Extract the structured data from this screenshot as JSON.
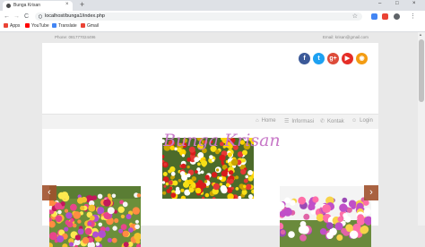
{
  "browser": {
    "tab_title": "Bunga Krisan",
    "new_tab": "+",
    "tab_close": "×",
    "url": "localhost/bunga1/index.php",
    "window_controls": [
      "–",
      "□",
      "×"
    ],
    "nav": {
      "back": "←",
      "forward": "→",
      "reload": "C",
      "star": "☆",
      "menu": "⋮"
    }
  },
  "bookmarks": [
    {
      "label": "Apps",
      "icon": "apps-icon",
      "color": "#ea4335"
    },
    {
      "label": "YouTube",
      "icon": "youtube-icon",
      "color": "#ff0000"
    },
    {
      "label": "Translate",
      "icon": "translate-icon",
      "color": "#4285f4"
    },
    {
      "label": "Gmail",
      "icon": "gmail-icon",
      "color": "#ea4335"
    }
  ],
  "topbar": {
    "phone": "Phone: 081777024496",
    "email": "Email: krisan@gmail.com"
  },
  "social": [
    {
      "name": "facebook-icon",
      "glyph": "f",
      "color": "#3b5998"
    },
    {
      "name": "twitter-icon",
      "glyph": "t",
      "color": "#1da1f2"
    },
    {
      "name": "google-plus-icon",
      "glyph": "g+",
      "color": "#dd4b39"
    },
    {
      "name": "youtube-icon",
      "glyph": "▶",
      "color": "#e52d27"
    },
    {
      "name": "rss-icon",
      "glyph": "◉",
      "color": "#f39c12"
    }
  ],
  "menu": [
    {
      "icon": "⌂",
      "label": "Home"
    },
    {
      "icon": "☰",
      "label": "Informasi"
    },
    {
      "icon": "✆",
      "label": "Kontak"
    },
    {
      "icon": "☺",
      "label": "Login"
    }
  ],
  "slider": {
    "caption": "Bunga Krisan",
    "prev": "‹",
    "next": "›"
  },
  "colors": {
    "caption": "#c879c8",
    "arrow": "#a0522d"
  }
}
